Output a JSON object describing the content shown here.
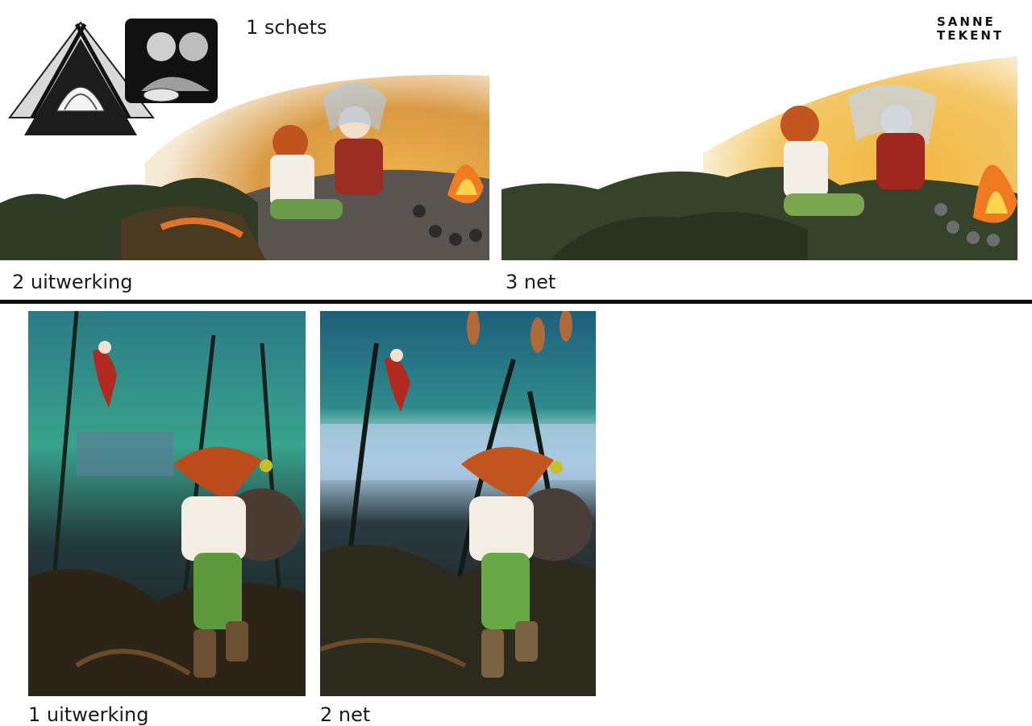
{
  "brand": {
    "line1": "SANNE",
    "line2": "TEKENT"
  },
  "captions": {
    "sketch": "1 schets",
    "top_step2": "2 uitwerking",
    "top_step3": "3 net",
    "bottom_step1": "1 uitwerking",
    "bottom_step2": "2 net"
  },
  "colors": {
    "divider": "#0d0d0d",
    "sky_warm": "#e9a23a",
    "leaves": "#3a4a2e",
    "forest_teal": "#1f4f5e"
  }
}
